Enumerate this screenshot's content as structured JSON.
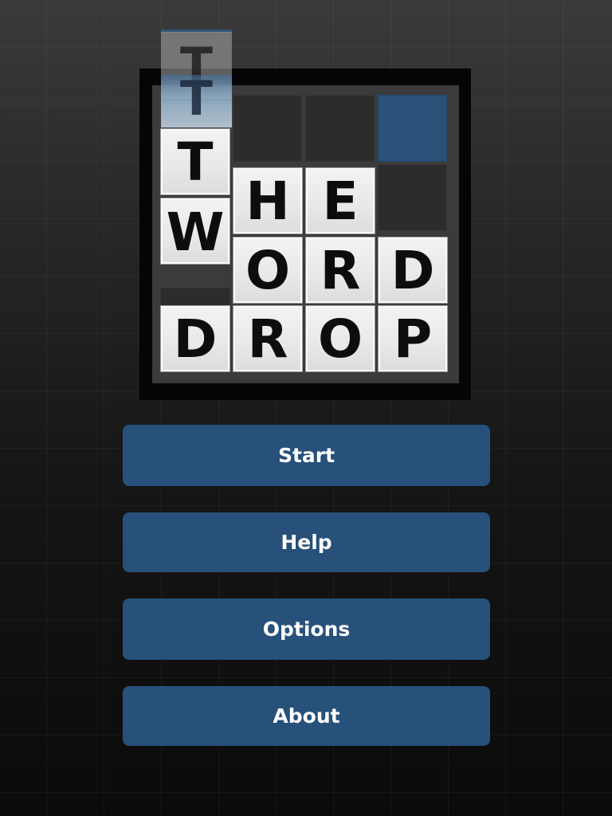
{
  "logo": {
    "title_rows": [
      "THE",
      "WORD",
      "DROP"
    ],
    "falling_letter": "T",
    "tiles": [
      {
        "letter": "T"
      },
      {
        "letter": "W"
      },
      {
        "letter": "H"
      },
      {
        "letter": "E"
      },
      {
        "letter": "O"
      },
      {
        "letter": "R"
      },
      {
        "letter": "D"
      },
      {
        "letter": "D"
      },
      {
        "letter": "R"
      },
      {
        "letter": "O"
      },
      {
        "letter": "P"
      }
    ]
  },
  "menu": {
    "start_label": "Start",
    "help_label": "Help",
    "options_label": "Options",
    "about_label": "About"
  },
  "colors": {
    "button_blue": "#27507a",
    "highlight_cell_blue": "#2a5279",
    "tile_face": "#eeeeee",
    "background": "#141414"
  }
}
